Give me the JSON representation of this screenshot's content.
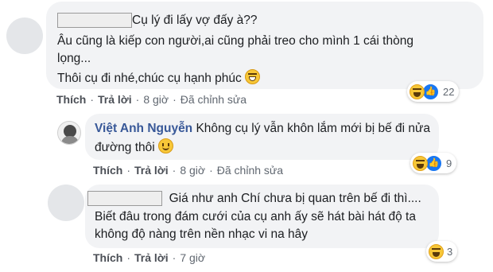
{
  "comments": [
    {
      "lines": [
        "Cụ lý đi lấy vợ đấy à??",
        "Âu cũng là kiếp con người,ai cũng phải treo cho mình 1 cái thòng",
        "lọng...",
        "Thôi cụ đi nhé,chúc cụ hạnh phúc"
      ],
      "actions": {
        "like": "Thích",
        "reply": "Trả lời",
        "time": "8 giờ",
        "edited": "Đã chỉnh sửa"
      },
      "reactions": {
        "icons": [
          "haha-icon",
          "like-icon"
        ],
        "count": "22"
      }
    },
    {
      "author": "Việt Anh Nguyễn",
      "lines": [
        "Không cụ lý vẫn khôn lắm mới bị bế đi nửa",
        "đường thôi"
      ],
      "actions": {
        "like": "Thích",
        "reply": "Trả lời",
        "time": "8 giờ",
        "edited": "Đã chỉnh sửa"
      },
      "reactions": {
        "icons": [
          "haha-icon",
          "like-icon"
        ],
        "count": "9"
      }
    },
    {
      "lines": [
        "Giá như anh Chí chưa bị quan trên bế đi thì....",
        "Biết đâu trong đám cưới của cụ anh ấy sẽ hát bài hát độ ta",
        "không độ nàng trên nền nhạc vi na hây"
      ],
      "actions": {
        "like": "Thích",
        "reply": "Trả lời",
        "time": "7 giờ"
      },
      "reactions": {
        "icons": [
          "haha-icon"
        ],
        "count": "3"
      }
    }
  ],
  "colors": {
    "bubble": "#f2f3f5",
    "author": "#385898",
    "meta": "#606770",
    "like_blue": "#1877f2"
  }
}
